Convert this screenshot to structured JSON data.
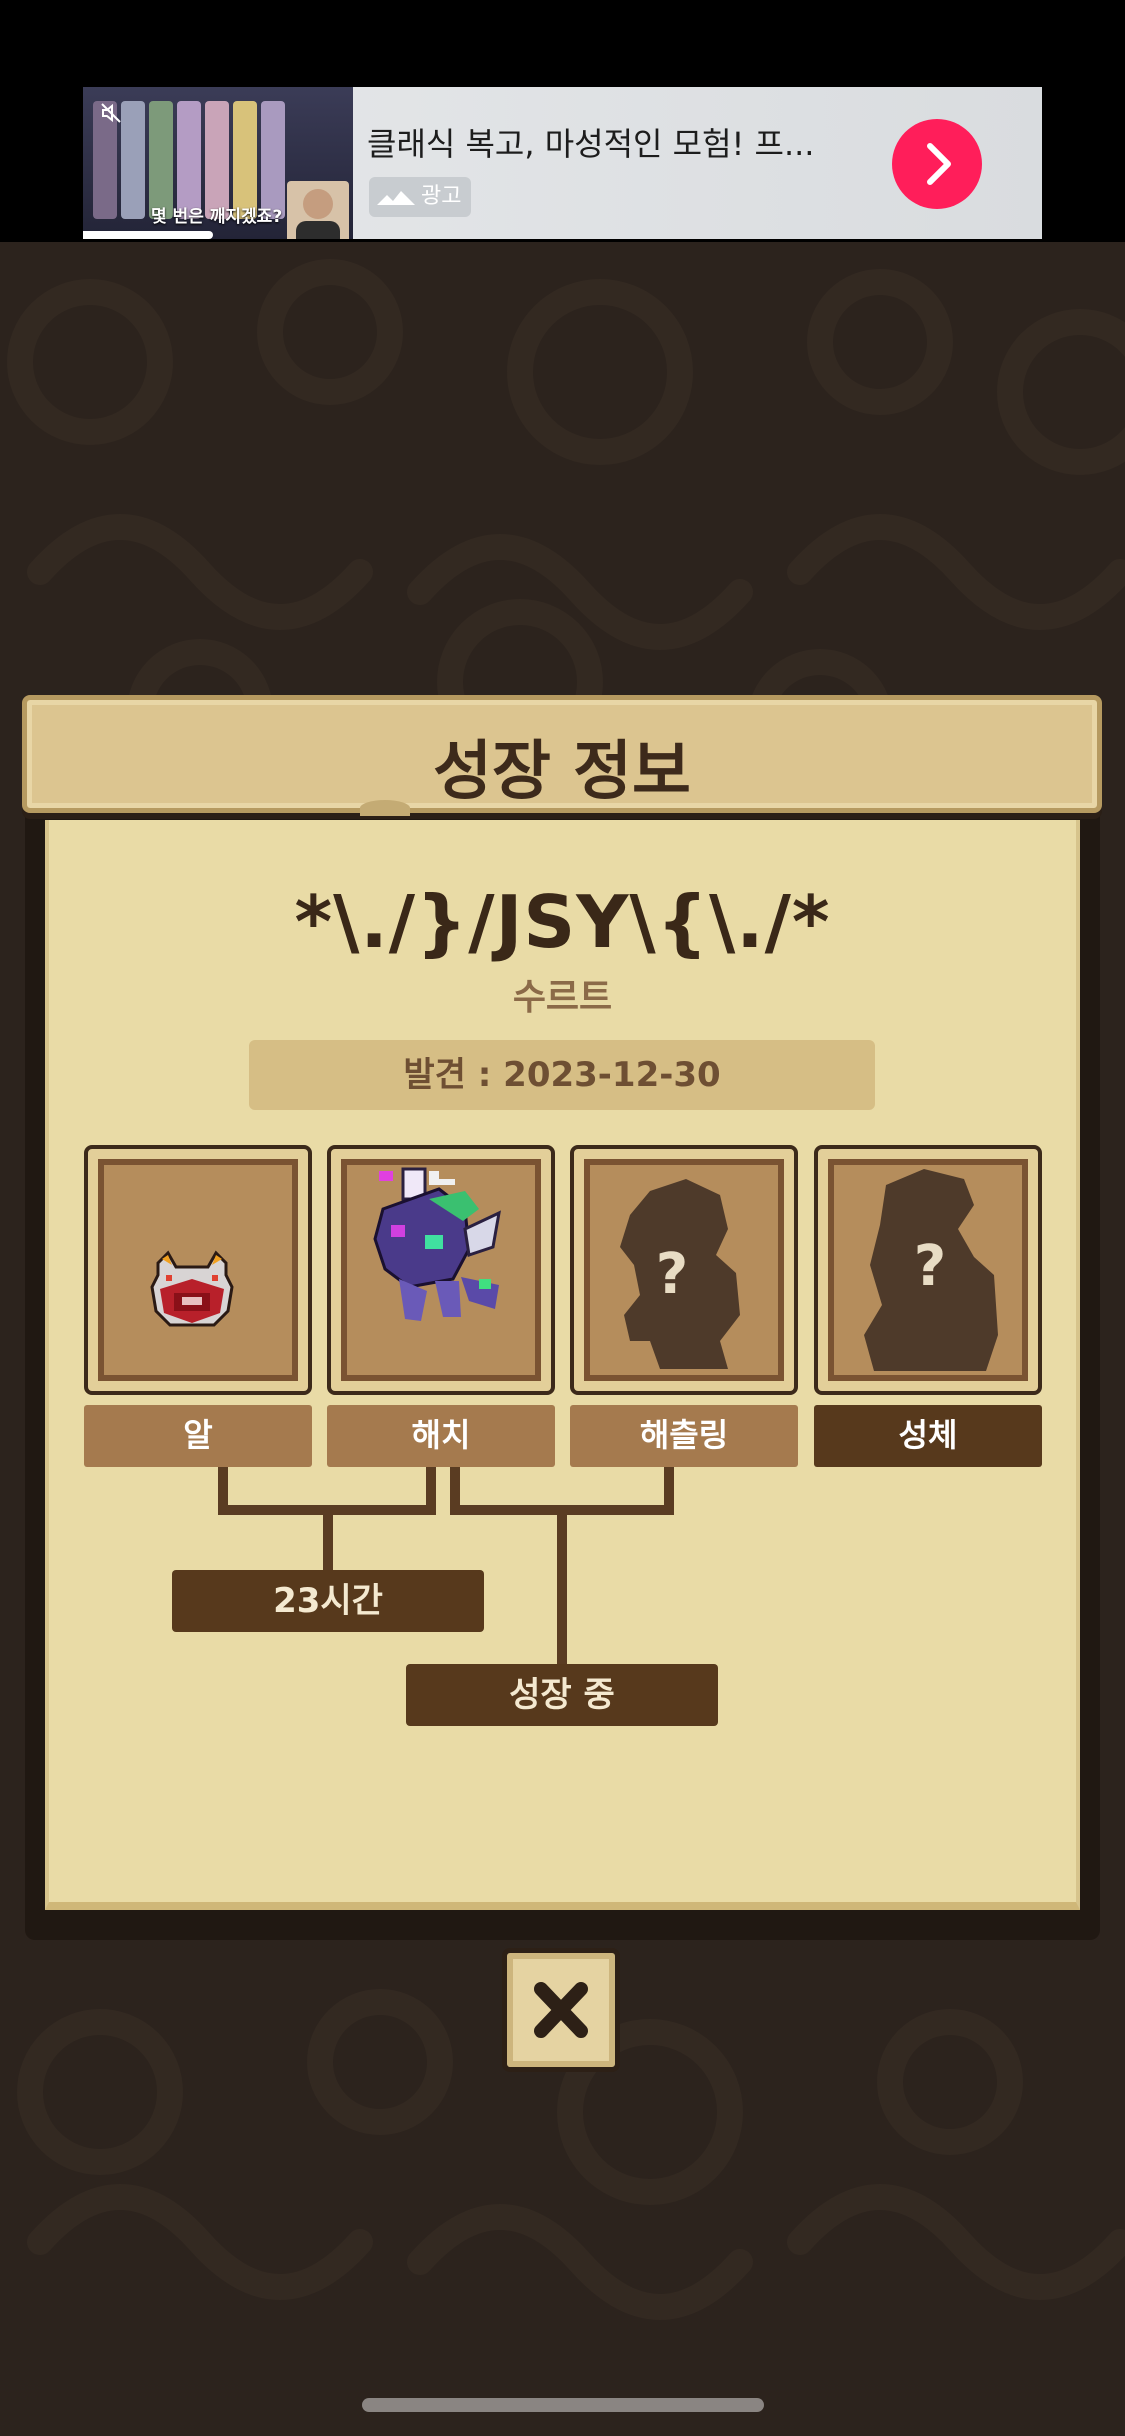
{
  "ad": {
    "title": "클래식 복고, 마성적인 모험! 프...",
    "badge_label": "광고",
    "thumbnail_caption": "몇 번은 깨지겠죠?",
    "go_icon": "chevron-right-icon",
    "close_icon": "close-icon"
  },
  "dialog": {
    "title": "성장 정보",
    "pet_name": "*\\./}/JSY\\{\\./*",
    "species": "수르트",
    "discovered": "발견 : 2023-12-30",
    "stages": [
      {
        "label": "알",
        "state": "done"
      },
      {
        "label": "해치",
        "state": "done"
      },
      {
        "label": "해츨링",
        "state": "locked"
      },
      {
        "label": "성체",
        "state": "locked"
      }
    ],
    "durations": {
      "egg_to_hatch": "23시간",
      "hatch_to_hatchling": "성장 중"
    },
    "close_icon": "close-x-icon"
  },
  "colors": {
    "background": "#2c231d",
    "parchment": "#e9dba6",
    "dark_brown": "#57391c",
    "ad_accent": "#ff1e5a"
  }
}
